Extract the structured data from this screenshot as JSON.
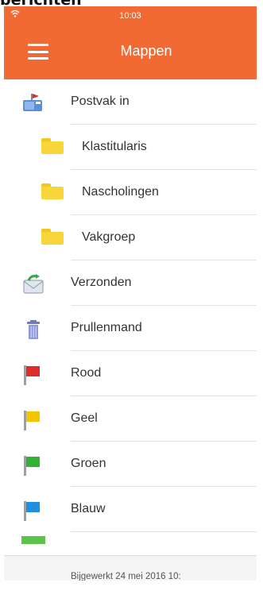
{
  "caption": "berichten",
  "status_bar": {
    "time": "10:03",
    "wifi_icon": "wifi-icon"
  },
  "nav": {
    "title": "Mappen",
    "menu_icon": "hamburger-menu-icon"
  },
  "colors": {
    "accent": "#f26a33",
    "folder": "#f8d53a",
    "flag_red": "#e12b2b",
    "flag_yellow": "#f5c400",
    "flag_green": "#34b233",
    "flag_blue": "#1f8fe0"
  },
  "folders": [
    {
      "label": "Postvak in",
      "icon": "inbox-mailbox-icon"
    },
    {
      "label": "Klastitularis",
      "icon": "folder-icon"
    },
    {
      "label": "Nascholingen",
      "icon": "folder-icon"
    },
    {
      "label": "Vakgroep",
      "icon": "folder-icon"
    },
    {
      "label": "Verzonden",
      "icon": "sent-envelope-icon"
    },
    {
      "label": "Prullenmand",
      "icon": "trash-icon"
    },
    {
      "label": "Rood",
      "icon": "red-flag-icon"
    },
    {
      "label": "Geel",
      "icon": "yellow-flag-icon"
    },
    {
      "label": "Groen",
      "icon": "green-flag-icon"
    },
    {
      "label": "Blauw",
      "icon": "blue-flag-icon"
    }
  ],
  "footer": {
    "status": "Bijgewerkt 24 mei 2016 10:"
  }
}
